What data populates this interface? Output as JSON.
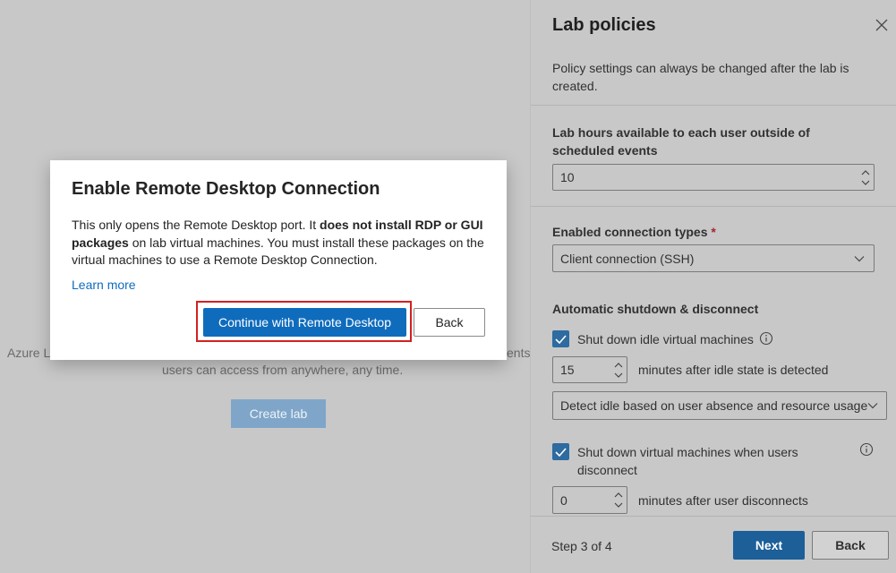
{
  "background": {
    "left_text": "Azure La",
    "right_text": "ents",
    "line2": "users can access from anywhere, any time.",
    "create_button": "Create lab"
  },
  "panel": {
    "title": "Lab policies",
    "description": "Policy settings can always be changed after the lab is created.",
    "lab_hours_label": "Lab hours available to each user outside of scheduled events",
    "lab_hours_value": "10",
    "connection_types_label": "Enabled connection types",
    "required_marker": "*",
    "connection_types_value": "Client connection (SSH)",
    "auto_shutdown_label": "Automatic shutdown & disconnect",
    "shutdown_idle_label": "Shut down idle virtual machines",
    "idle_minutes_value": "15",
    "idle_minutes_suffix": "minutes after idle state is detected",
    "idle_detect_value": "Detect idle based on user absence and resource usage",
    "shutdown_disconnect_label": "Shut down virtual machines when users disconnect",
    "disconnect_minutes_value": "0",
    "disconnect_minutes_suffix": "minutes after user disconnects",
    "step_text": "Step 3 of 4",
    "next_button": "Next",
    "back_button": "Back"
  },
  "dialog": {
    "title": "Enable Remote Desktop Connection",
    "body_part1": "This only opens the Remote Desktop port. It ",
    "body_bold": "does not install RDP or GUI packages",
    "body_part2": " on lab virtual machines. You must install these packages on the virtual machines to use a Remote Desktop Connection.",
    "learn_more": "Learn more",
    "primary_button": "Continue with Remote Desktop",
    "secondary_button": "Back"
  },
  "colors": {
    "primary": "#0f6cbd",
    "highlight": "#d32020",
    "checkbox": "#2d6ba0"
  }
}
